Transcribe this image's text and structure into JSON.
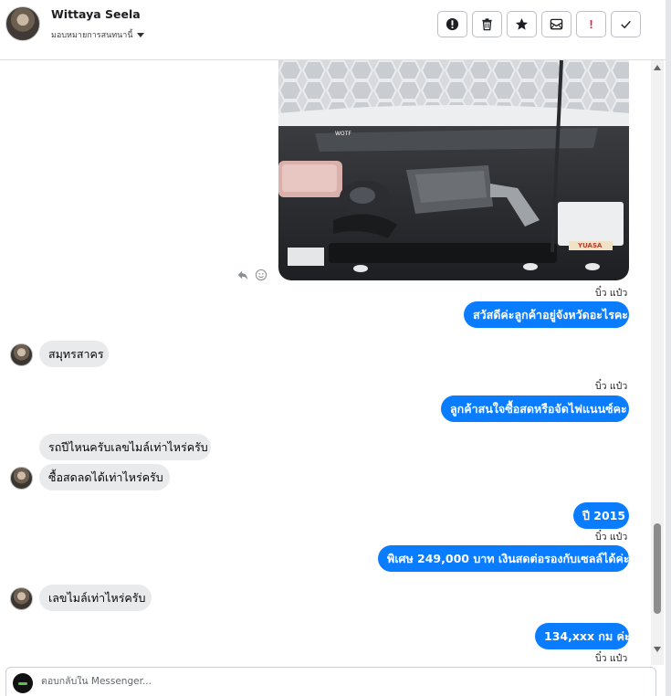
{
  "header": {
    "contact_name": "Wittaya Seela",
    "assign_label": "มอบหมายการสนทนานี้",
    "toolbar": [
      {
        "icon": "info-alert-icon"
      },
      {
        "icon": "trash-icon"
      },
      {
        "icon": "star-icon"
      },
      {
        "icon": "archive-icon"
      },
      {
        "icon": "spam-icon",
        "glyph": "!"
      },
      {
        "icon": "check-icon"
      }
    ]
  },
  "messages": {
    "meta_1": "บิ๋ว แป๋ว",
    "out_1": "สวัสดีค่ะลูกค้าอยู่จังหวัดอะไรคะ",
    "in_1": "สมุทรสาคร",
    "meta_2": "บิ๋ว แป๋ว",
    "out_2": "ลูกค้าสนใจซื้อสดหรือจัดไฟแนนซ์คะ",
    "in_2": "รถปีไหนครับเลขไมล์เท่าไหร่ครับ",
    "in_3": "ซื้อสดลดได้เท่าไหร่ครับ",
    "out_3": "ปี  2015",
    "meta_3": "บิ๋ว แป๋ว",
    "out_4": "พิเศษ 249,000 บาท   เงินสดต่อรองกับเซลล์ได้ค่ะ",
    "in_4": "เลขไมล์เท่าไหร่ครับ",
    "out_5": "134,xxx  กม  ค่ะ",
    "meta_4": "บิ๋ว แป๋ว"
  },
  "composer": {
    "placeholder": "ตอบกลับใน Messenger..."
  },
  "colors": {
    "outgoing_bubble": "#0a7cff",
    "incoming_bubble": "#e9eaec",
    "spam_red": "#e41e3f"
  }
}
